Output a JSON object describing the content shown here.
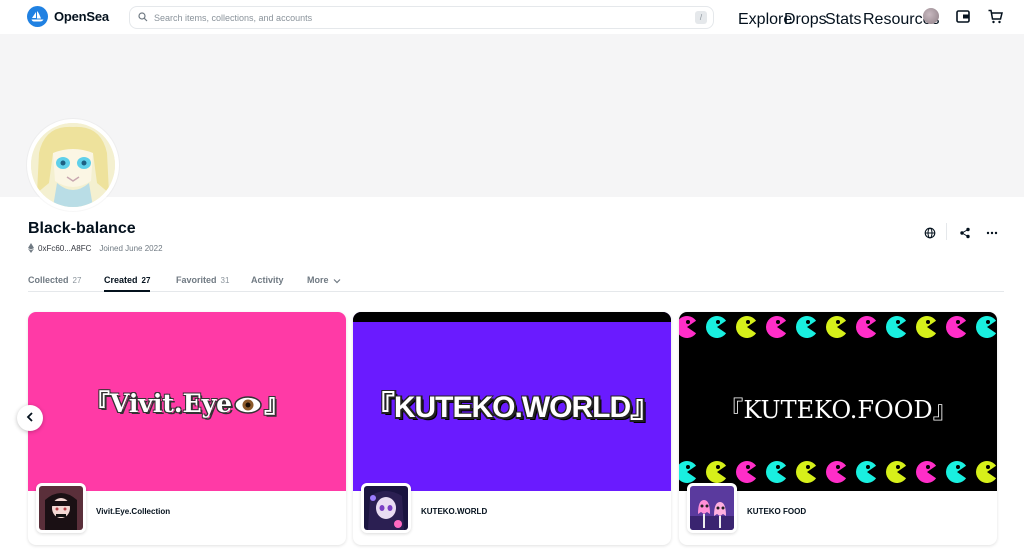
{
  "header": {
    "brand": "OpenSea",
    "search_placeholder": "Search items, collections, and accounts",
    "search_shortcut": "/",
    "nav": [
      "Explore",
      "Drops",
      "Stats",
      "Resources"
    ]
  },
  "profile": {
    "name": "Black-balance",
    "address": "0xFc60...A8FC",
    "joined": "Joined June 2022"
  },
  "tabs": [
    {
      "label": "Collected",
      "count": "27"
    },
    {
      "label": "Created",
      "count": "27"
    },
    {
      "label": "Favorited",
      "count": "31"
    },
    {
      "label": "Activity",
      "count": ""
    },
    {
      "label": "More",
      "count": ""
    }
  ],
  "cards": [
    {
      "banner_text": "『Vivit.Eye",
      "banner_text_end": "』",
      "name": "Vivit.Eye.Collection",
      "bg": "#ff3aa6"
    },
    {
      "banner_text": "『KUTEKO.WORLD』",
      "name": "KUTEKO.WORLD",
      "bg": "#6a1bff"
    },
    {
      "banner_text": "『KUTEKO.FOOD』",
      "name": "KUTEKO FOOD",
      "bg": "#000000"
    }
  ],
  "colors": {
    "brand": "#2081e2",
    "text": "#04111d",
    "muted": "#707a83",
    "banner": "#f5f5f6"
  }
}
